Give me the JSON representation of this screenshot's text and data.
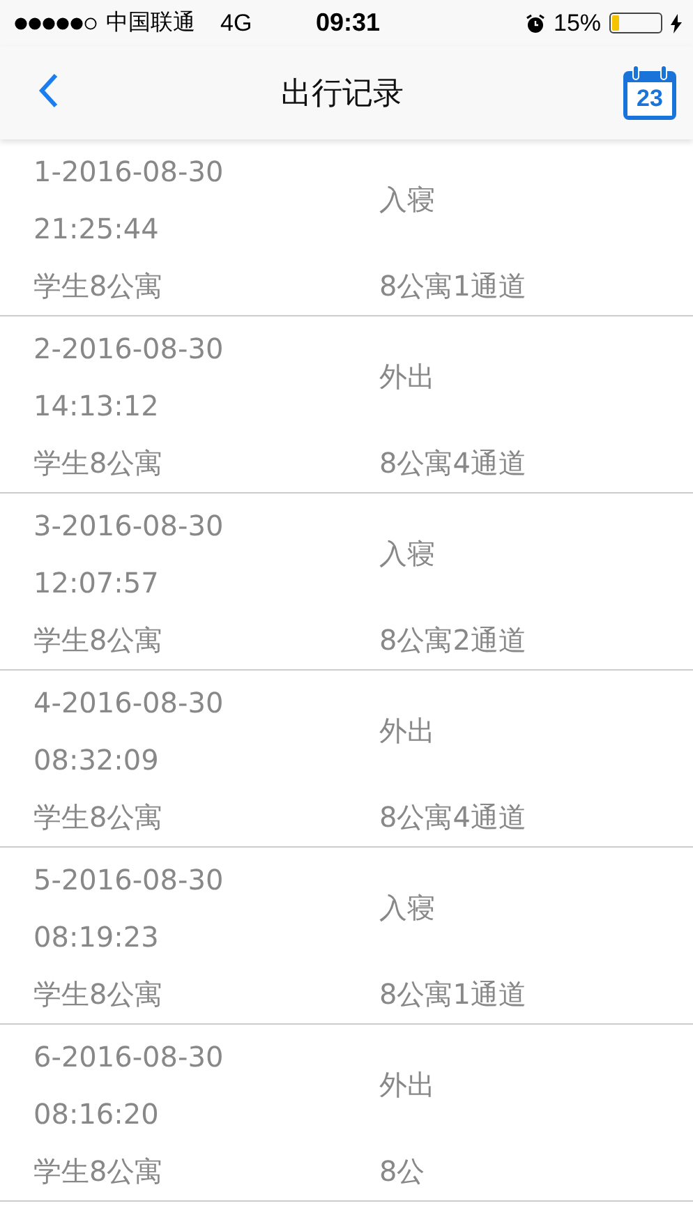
{
  "status_bar": {
    "carrier": "中国联通",
    "network": "4G",
    "time": "09:31",
    "battery": "15%"
  },
  "nav": {
    "title": "出行记录",
    "calendar_day": "23"
  },
  "records": [
    {
      "date": "1-2016-08-30",
      "time": "21:25:44",
      "building": "学生8公寓",
      "action": "入寝",
      "gate": "8公寓1通道"
    },
    {
      "date": "2-2016-08-30",
      "time": "14:13:12",
      "building": "学生8公寓",
      "action": "外出",
      "gate": "8公寓4通道"
    },
    {
      "date": "3-2016-08-30",
      "time": "12:07:57",
      "building": "学生8公寓",
      "action": "入寝",
      "gate": "8公寓2通道"
    },
    {
      "date": "4-2016-08-30",
      "time": "08:32:09",
      "building": "学生8公寓",
      "action": "外出",
      "gate": "8公寓4通道"
    },
    {
      "date": "5-2016-08-30",
      "time": "08:19:23",
      "building": "学生8公寓",
      "action": "入寝",
      "gate": "8公寓1通道"
    },
    {
      "date": "6-2016-08-30",
      "time": "08:16:20",
      "building": "学生8公寓",
      "action": "外出",
      "gate": "8公"
    }
  ]
}
